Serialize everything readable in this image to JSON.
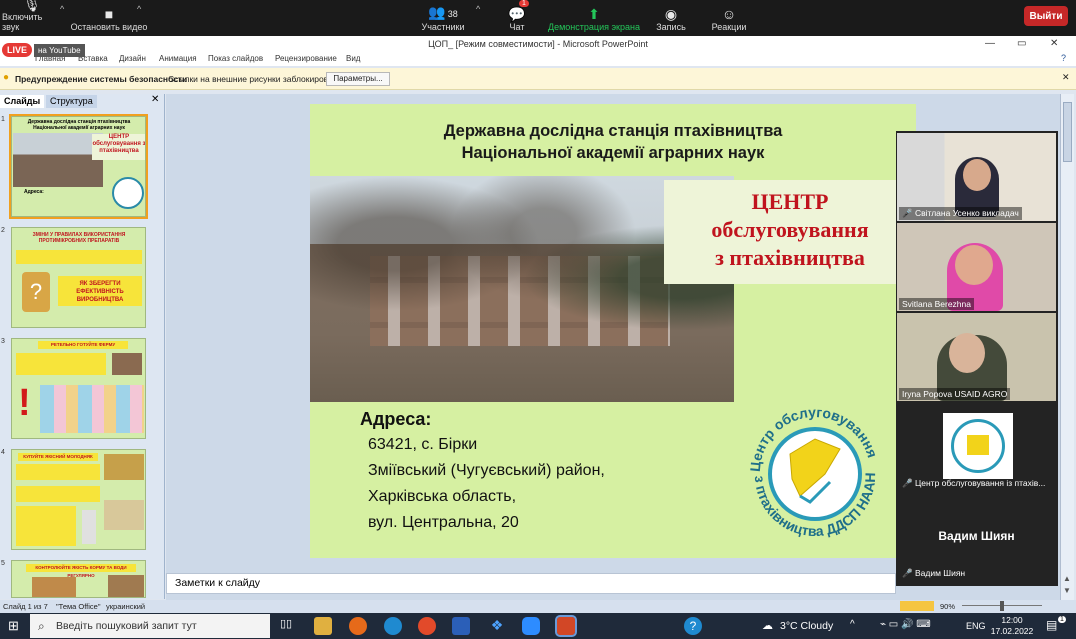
{
  "zoom": {
    "unmute": {
      "label": "Включить звук",
      "icon": "mic-muted-icon"
    },
    "video": {
      "label": "Остановить видео",
      "icon": "camera-icon"
    },
    "participants": {
      "label": "Участники",
      "count": "38",
      "icon": "people-icon"
    },
    "chat": {
      "label": "Чат",
      "badge": "1",
      "icon": "chat-icon"
    },
    "share": {
      "label": "Демонстрация экрана",
      "icon": "share-screen-icon",
      "color": "#24c65a"
    },
    "record": {
      "label": "Запись",
      "icon": "record-icon"
    },
    "reactions": {
      "label": "Реакции",
      "icon": "emoji-icon"
    },
    "leave": {
      "label": "Выйти",
      "color": "#c62828"
    }
  },
  "live": {
    "badge": "LIVE",
    "label": "на YouTube"
  },
  "window": {
    "title": "ЦОП_ [Режим совместимости] - Microsoft PowerPoint"
  },
  "ribbon": {
    "tabs": [
      "Главная",
      "Вставка",
      "Дизайн",
      "Анимация",
      "Показ слайдов",
      "Рецензирование",
      "Вид"
    ]
  },
  "security": {
    "title": "Предупреждение системы безопасности",
    "message": "Ссылки на внешние рисунки заблокированы",
    "button": "Параметры..."
  },
  "panel": {
    "tab_slides": "Слайды",
    "tab_outline": "Структура",
    "close": "✕"
  },
  "thumbs": [
    {
      "num": "1",
      "title": "Державна дослідна станція птахівництва Національної академії аграрних наук",
      "box": "ЦЕНТР обслуговування з птахівництва",
      "addr": "Адреса:"
    },
    {
      "num": "2",
      "title": "ЗМІНИ У ПРАВИЛАХ ВИКОРИСТАННЯ ПРОТИМІКРОБНИХ ПРЕПАРАТІВ",
      "box": "ЯК ЗБЕРЕГТИ ЕФЕКТИВНІСТЬ ВИРОБНИЦТВА"
    },
    {
      "num": "3",
      "title": "РЕТЕЛЬНО ГОТУЙТЕ ФЕРМУ"
    },
    {
      "num": "4",
      "title": "КУПУЙТЕ ЯКІСНИЙ МОЛОДНЯК"
    },
    {
      "num": "5",
      "title": "КОНТРОЛЮЙТЕ ЯКІСТЬ КОРМУ ТА ВОДИ РЕГУЛЯРНО"
    }
  ],
  "slide": {
    "title_line1": "Державна дослідна станція птахівництва",
    "title_line2": "Національної академії аграрних наук",
    "center_line1": "ЦЕНТР",
    "center_line2": "обслуговування",
    "center_line3": "з птахівництва",
    "addr_label": "Адреса:",
    "addr_lines": [
      "63421, с. Бірки",
      "Зміївський (Чугуєвський) район,",
      "Харківська область,",
      "вул. Центральна, 20"
    ],
    "logo_ring_top": "Центр обслуговування",
    "logo_ring_bottom": "з птахівництва ДДСП НААН"
  },
  "notes": {
    "placeholder": "Заметки к слайду"
  },
  "status": {
    "slide": "Слайд 1 из 7",
    "theme": "\"Тема Office\"",
    "lang": "украинский",
    "zoom": "90%"
  },
  "participants": [
    {
      "name": "Світлана Усенко викладач",
      "muted": true
    },
    {
      "name": "Svitlana Berezhna",
      "muted": false
    },
    {
      "name": "Iryna Popova USAID AGRO",
      "muted": false
    },
    {
      "name": "Центр обслуговування із птахів...",
      "muted": true
    },
    {
      "name": "Вадим Шиян",
      "display": "Вадим Шиян",
      "muted": true
    }
  ],
  "taskbar": {
    "search": "Введіть пошуковий запит тут",
    "weather": "3°C  Cloudy",
    "lang": "ENG",
    "time": "12:00",
    "date": "17.02.2022",
    "notif": "1"
  }
}
